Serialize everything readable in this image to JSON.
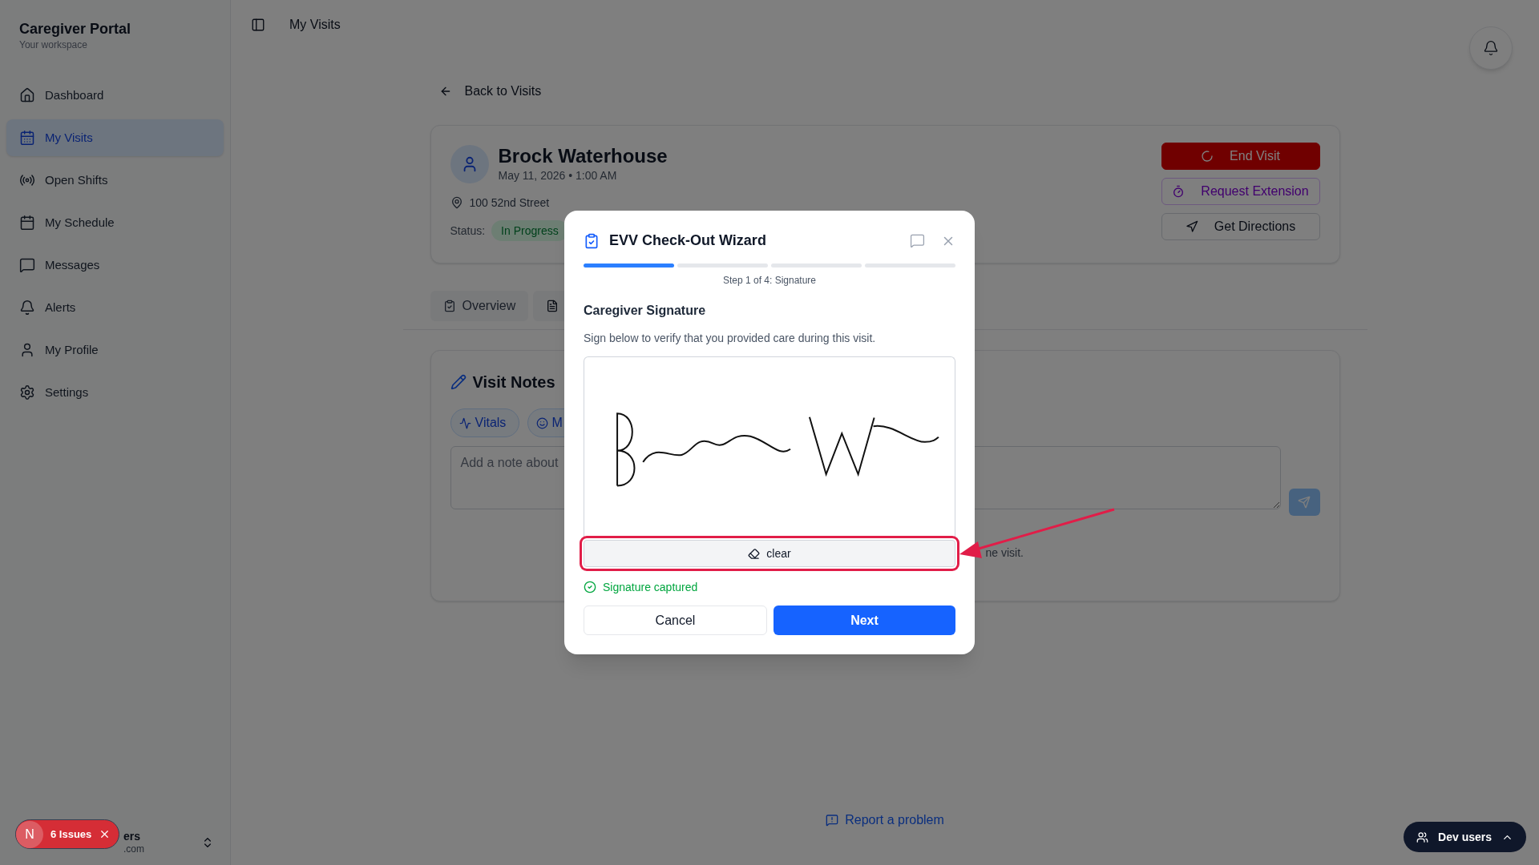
{
  "sidebar": {
    "title": "Caregiver Portal",
    "subtitle": "Your workspace",
    "items": [
      {
        "label": "Dashboard",
        "selected": false
      },
      {
        "label": "My Visits",
        "selected": true
      },
      {
        "label": "Open Shifts",
        "selected": false
      },
      {
        "label": "My Schedule",
        "selected": false
      },
      {
        "label": "Messages",
        "selected": false
      },
      {
        "label": "Alerts",
        "selected": false
      },
      {
        "label": "My Profile",
        "selected": false
      },
      {
        "label": "Settings",
        "selected": false
      }
    ],
    "user": {
      "name": "ers",
      "email": ".com"
    }
  },
  "header": {
    "title": "My Visits"
  },
  "back_link": "Back to Visits",
  "visit": {
    "name": "Brock Waterhouse",
    "datetime": "May 11, 2026 • 1:00 AM",
    "address": "100 52nd Street",
    "status_label": "Status:",
    "status": "In Progress",
    "actions": [
      {
        "label": "End Visit",
        "kind": "danger"
      },
      {
        "label": "Request Extension",
        "kind": "extend"
      },
      {
        "label": "Get Directions",
        "kind": "directions"
      }
    ]
  },
  "tabs": [
    {
      "kind": "labeled",
      "label": "Overview"
    },
    {
      "kind": "covered"
    }
  ],
  "notes": {
    "title": "Visit Notes",
    "chips": [
      {
        "label": "Vitals",
        "kind": "vitals"
      },
      {
        "label": "M",
        "kind": "mood"
      }
    ],
    "placeholder": "Add a note about",
    "hint": "ne visit."
  },
  "modal": {
    "title": "EVV Check-Out Wizard",
    "steps": [
      {
        "complete": true
      },
      {
        "complete": false
      },
      {
        "complete": false
      },
      {
        "complete": false
      }
    ],
    "step_text": "Step 1 of 4: Signature",
    "heading": "Caregiver Signature",
    "description": "Sign below to verify that you provided care during this visit.",
    "signature_captured": true,
    "clear": "clear",
    "status": "Signature captured",
    "cancel": "Cancel",
    "next": "Next"
  },
  "report_link": "Report a problem",
  "issues": {
    "badge": "N",
    "label": "6 Issues"
  },
  "dev_users": "Dev users"
}
